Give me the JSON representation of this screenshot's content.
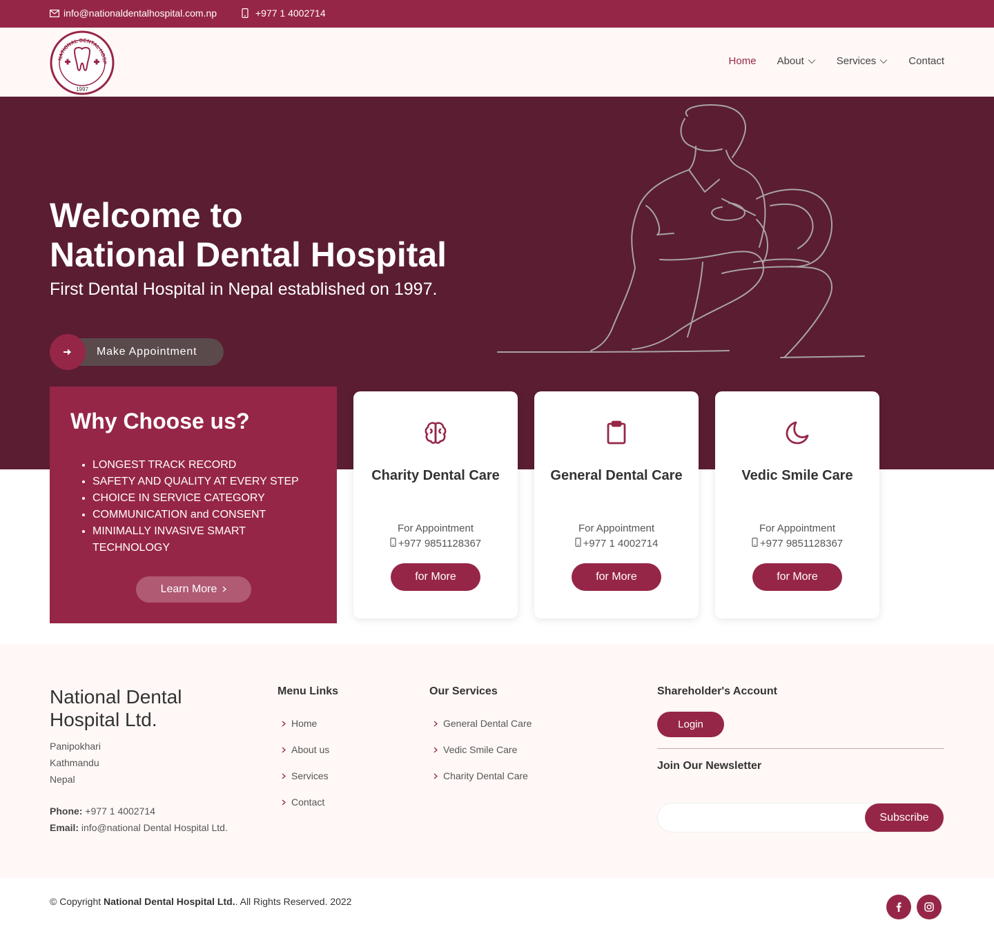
{
  "colors": {
    "brand": "#962647",
    "hero_bg": "#5b1d31",
    "footer_bg": "#fff8f6"
  },
  "topbar": {
    "email": "info@nationaldentalhospital.com.np",
    "phone": "+977 1 4002714",
    "email_icon": "envelope-icon",
    "phone_icon": "mobile-icon"
  },
  "header": {
    "logo_year": "1997",
    "logo_text": "NATIONAL DENTAL HOSPITAL LTD",
    "nav": [
      {
        "label": "Home",
        "active": true
      },
      {
        "label": "About",
        "dropdown": true
      },
      {
        "label": "Services",
        "dropdown": true
      },
      {
        "label": "Contact"
      }
    ]
  },
  "hero": {
    "title_line1": "Welcome to",
    "title_line2": "National Dental Hospital",
    "subtitle": "First Dental Hospital in Nepal established on 1997.",
    "cta": "Make Appointment"
  },
  "why": {
    "title": "Why Choose us?",
    "items": [
      "LONGEST TRACK RECORD",
      "SAFETY AND QUALITY AT EVERY STEP",
      "CHOICE IN SERVICE CATEGORY",
      "COMMUNICATION and CONSENT",
      "MINIMALLY INVASIVE SMART TECHNOLOGY"
    ],
    "button": "Learn More"
  },
  "services": [
    {
      "icon": "brain-icon",
      "title": "Charity Dental Care",
      "for": "For Appointment",
      "phone": "+977 9851128367",
      "button": "for More"
    },
    {
      "icon": "clipboard-icon",
      "title": "General Dental Care",
      "for": "For Appointment",
      "phone": "+977 1 4002714",
      "button": "for More"
    },
    {
      "icon": "moon-icon",
      "title": "Vedic Smile Care",
      "for": "For Appointment",
      "phone": "+977 9851128367",
      "button": "for More"
    }
  ],
  "footer": {
    "brand_line1": "National Dental",
    "brand_line2": "Hospital Ltd.",
    "address": [
      "Panipokhari",
      "Kathmandu",
      "Nepal"
    ],
    "phone_label": "Phone:",
    "phone": "+977 1 4002714",
    "email_label": "Email:",
    "email": "info@national Dental Hospital Ltd.",
    "menu_title": "Menu Links",
    "menu": [
      "Home",
      "About us",
      "Services",
      "Contact"
    ],
    "services_title": "Our Services",
    "services": [
      "General Dental Care",
      "Vedic Smile Care",
      "Charity Dental Care"
    ],
    "shareholder_title": "Shareholder's Account",
    "login": "Login",
    "newsletter_title": "Join Our Newsletter",
    "newsletter_placeholder": "",
    "subscribe": "Subscribe"
  },
  "bottom": {
    "copy_prefix": "© Copyright ",
    "copy_brand": "National Dental Hospital Ltd.",
    "copy_suffix": ". All Rights Reserved. 2022",
    "social": [
      "facebook-icon",
      "instagram-icon"
    ]
  }
}
